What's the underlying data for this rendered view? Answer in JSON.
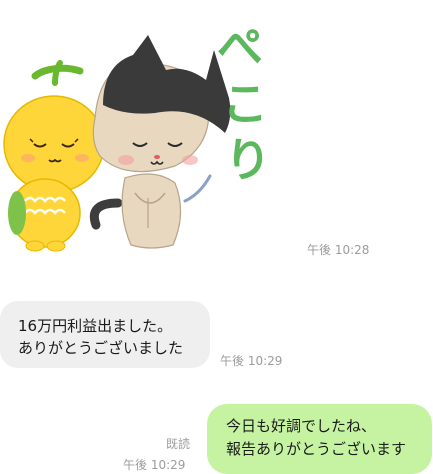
{
  "sticker": {
    "text": "ぺこり",
    "time": "午後 10:28"
  },
  "incoming": {
    "lines": [
      "16万円利益出ました。",
      "ありがとうございました"
    ],
    "time": "午後 10:29"
  },
  "outgoing": {
    "lines": [
      "今日も好調でしたね、",
      "報告ありがとうございます"
    ],
    "read": "既読",
    "time": "午後 10:29"
  },
  "colors": {
    "incoming_bubble": "#efefef",
    "outgoing_bubble": "#c6f3a2",
    "timestamp": "#9c9c9c",
    "sticker_text": "#5cb85c"
  }
}
